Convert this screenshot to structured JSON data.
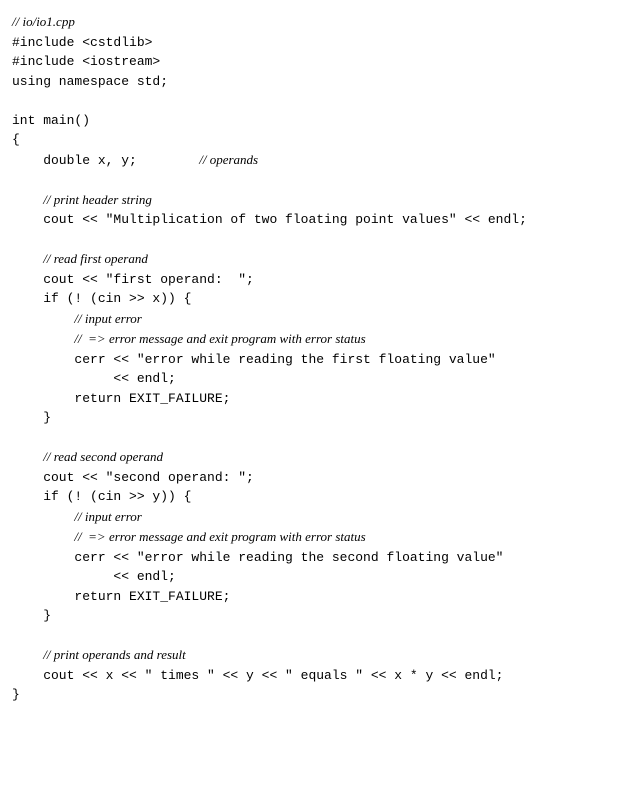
{
  "lines": [
    {
      "segments": [
        {
          "text": "// io/io1.cpp",
          "comment": true
        }
      ]
    },
    {
      "segments": [
        {
          "text": "#include <cstdlib>"
        }
      ]
    },
    {
      "segments": [
        {
          "text": "#include <iostream>"
        }
      ]
    },
    {
      "segments": [
        {
          "text": "using namespace std;"
        }
      ]
    },
    {
      "segments": [
        {
          "text": " "
        }
      ]
    },
    {
      "segments": [
        {
          "text": "int main()"
        }
      ]
    },
    {
      "segments": [
        {
          "text": "{"
        }
      ]
    },
    {
      "segments": [
        {
          "text": "    double x, y;        "
        },
        {
          "text": "// operands",
          "comment": true
        }
      ]
    },
    {
      "segments": [
        {
          "text": " "
        }
      ]
    },
    {
      "segments": [
        {
          "text": "    "
        },
        {
          "text": "// print header string",
          "comment": true
        }
      ]
    },
    {
      "segments": [
        {
          "text": "    cout << \"Multiplication of two floating point values\" << endl;"
        }
      ]
    },
    {
      "segments": [
        {
          "text": " "
        }
      ]
    },
    {
      "segments": [
        {
          "text": "    "
        },
        {
          "text": "// read first operand",
          "comment": true
        }
      ]
    },
    {
      "segments": [
        {
          "text": "    cout << \"first operand:  \";"
        }
      ]
    },
    {
      "segments": [
        {
          "text": "    if (! (cin >> x)) {"
        }
      ]
    },
    {
      "segments": [
        {
          "text": "        "
        },
        {
          "text": "// input error",
          "comment": true
        }
      ]
    },
    {
      "segments": [
        {
          "text": "        "
        },
        {
          "text": "//  => error message and exit program with error status",
          "comment": true
        }
      ]
    },
    {
      "segments": [
        {
          "text": "        cerr << \"error while reading the first floating value\""
        }
      ]
    },
    {
      "segments": [
        {
          "text": "             << endl;"
        }
      ]
    },
    {
      "segments": [
        {
          "text": "        return EXIT_FAILURE;"
        }
      ]
    },
    {
      "segments": [
        {
          "text": "    }"
        }
      ]
    },
    {
      "segments": [
        {
          "text": " "
        }
      ]
    },
    {
      "segments": [
        {
          "text": "    "
        },
        {
          "text": "// read second operand",
          "comment": true
        }
      ]
    },
    {
      "segments": [
        {
          "text": "    cout << \"second operand: \";"
        }
      ]
    },
    {
      "segments": [
        {
          "text": "    if (! (cin >> y)) {"
        }
      ]
    },
    {
      "segments": [
        {
          "text": "        "
        },
        {
          "text": "// input error",
          "comment": true
        }
      ]
    },
    {
      "segments": [
        {
          "text": "        "
        },
        {
          "text": "//  => error message and exit program with error status",
          "comment": true
        }
      ]
    },
    {
      "segments": [
        {
          "text": "        cerr << \"error while reading the second floating value\""
        }
      ]
    },
    {
      "segments": [
        {
          "text": "             << endl;"
        }
      ]
    },
    {
      "segments": [
        {
          "text": "        return EXIT_FAILURE;"
        }
      ]
    },
    {
      "segments": [
        {
          "text": "    }"
        }
      ]
    },
    {
      "segments": [
        {
          "text": " "
        }
      ]
    },
    {
      "segments": [
        {
          "text": "    "
        },
        {
          "text": "// print operands and result",
          "comment": true
        }
      ]
    },
    {
      "segments": [
        {
          "text": "    cout << x << \" times \" << y << \" equals \" << x * y << endl;"
        }
      ]
    },
    {
      "segments": [
        {
          "text": "}"
        }
      ]
    }
  ]
}
